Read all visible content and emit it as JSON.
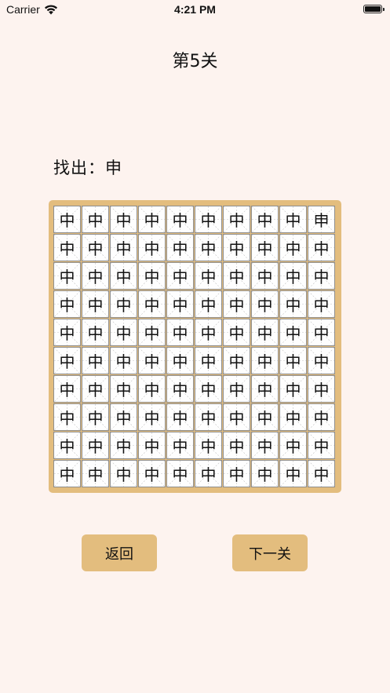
{
  "status_bar": {
    "carrier": "Carrier",
    "time": "4:21 PM"
  },
  "level": {
    "title": "第5关"
  },
  "target": {
    "label": "找出：",
    "char": "申"
  },
  "grid": {
    "rows": 10,
    "cols": 10,
    "default_char": "中",
    "odd_char": "申",
    "odd_position": {
      "row": 0,
      "col": 9
    }
  },
  "buttons": {
    "back": "返回",
    "next": "下一关"
  },
  "colors": {
    "background": "#fdf3ef",
    "accent": "#e3bd7e",
    "cell": "#fefefe"
  },
  "icons": {
    "wifi": "wifi-icon",
    "battery": "battery-icon"
  }
}
